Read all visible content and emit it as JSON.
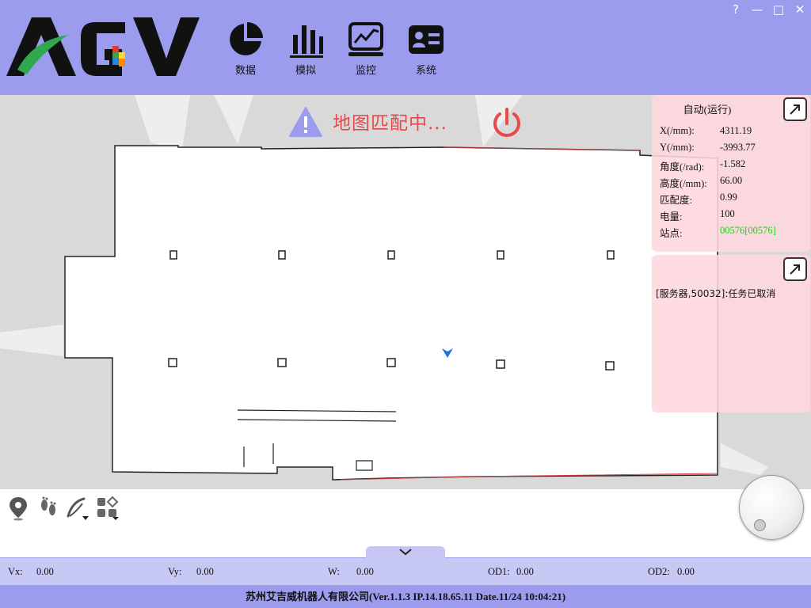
{
  "header": {
    "logo_text": "AGV",
    "nav": [
      {
        "label": "数据",
        "icon": "pie-chart-icon"
      },
      {
        "label": "模拟",
        "icon": "bar-chart-icon"
      },
      {
        "label": "监控",
        "icon": "line-chart-icon"
      },
      {
        "label": "系统",
        "icon": "id-card-icon"
      }
    ],
    "window_controls": [
      "?",
      "—",
      "□",
      "✕"
    ]
  },
  "map": {
    "status_text": "地图匹配中...",
    "status_icon": "warning-icon",
    "power_icon": "power-icon"
  },
  "info_panel": {
    "title": "自动(运行)",
    "rows": [
      {
        "label": "X(/mm):",
        "value": "4311.19"
      },
      {
        "label": "Y(/mm):",
        "value": "-3993.77"
      },
      {
        "label": "角度(/rad):",
        "value": "-1.582"
      },
      {
        "label": "高度(/mm):",
        "value": "66.00"
      },
      {
        "label": "匹配度:",
        "value": "0.99"
      },
      {
        "label": "电量:",
        "value": "100"
      },
      {
        "label": "站点:",
        "value": "00576[00576]"
      }
    ],
    "station_color": "#22cc22"
  },
  "message_panel": {
    "message": "[服务器,50032]:任务已取消"
  },
  "tools": [
    "location-pin-icon",
    "footprints-icon",
    "pen-path-icon",
    "shapes-icon"
  ],
  "status_bar": {
    "vx_label": "Vx:",
    "vx": "0.00",
    "vy_label": "Vy:",
    "vy": "0.00",
    "w_label": "W:",
    "w": "0.00",
    "od1_label": "OD1:",
    "od1": "0.00",
    "od2_label": "OD2:",
    "od2": "0.00"
  },
  "footer": {
    "text": "苏州艾吉威机器人有限公司(Ver.1.1.3 IP.14.18.65.11 Date.11/24 10:04:21)"
  }
}
